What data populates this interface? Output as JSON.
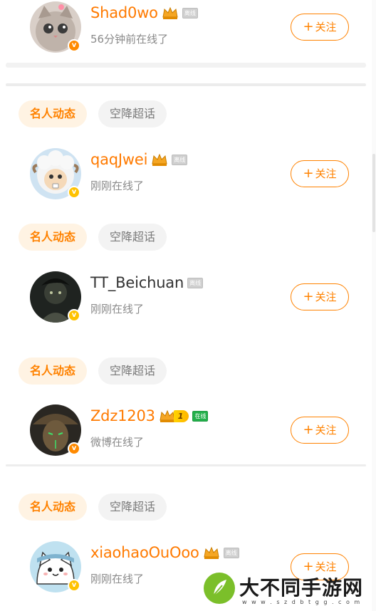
{
  "tags": {
    "active": "名人动态",
    "plain": "空降超话"
  },
  "follow_label": "关注",
  "follow_plus": "+",
  "users": [
    {
      "name": "Shad0wo",
      "name_style": "vip",
      "crown": true,
      "status_pill": "离线",
      "status_kind": "offline",
      "subtitle": "56分钟前在线了",
      "badge": "orange"
    },
    {
      "name": "qaqJwei",
      "name_style": "vip",
      "crown": true,
      "status_pill": "离线",
      "status_kind": "offline",
      "subtitle": "刚刚在线了",
      "badge": "yellow"
    },
    {
      "name": "TT_Beichuan",
      "name_style": "normal",
      "crown": false,
      "status_pill": "离线",
      "status_kind": "offline",
      "subtitle": "刚刚在线了",
      "badge": "yellow"
    },
    {
      "name": "Zdz1203",
      "name_style": "vip",
      "crown": true,
      "level": "1",
      "status_pill": "在线",
      "status_kind": "online",
      "subtitle": "微博在线了",
      "badge": "orange"
    },
    {
      "name": "xiaohaoOuOoo",
      "name_style": "vip",
      "crown": true,
      "status_pill": "离线",
      "status_kind": "offline",
      "subtitle": "刚刚在线了",
      "badge": "yellow"
    }
  ],
  "watermark": {
    "title": "大不同手游网",
    "url": "w w w . s z d b t g g . c o m"
  },
  "colors": {
    "accent": "#ff8200",
    "vip_name": "#ff7a00",
    "online": "#23b04b"
  }
}
